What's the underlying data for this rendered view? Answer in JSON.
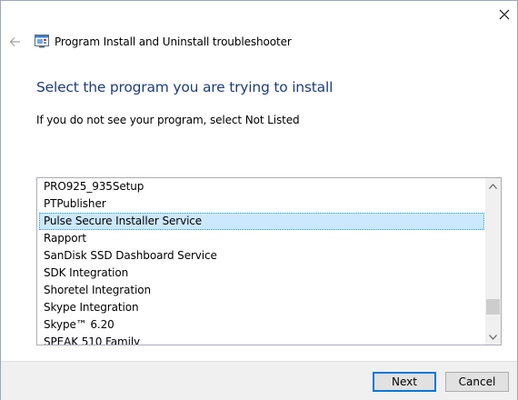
{
  "window": {
    "title": "Program Install and Uninstall troubleshooter"
  },
  "page": {
    "heading": "Select the program you are trying to install",
    "instruction": "If you do not see your program, select Not Listed"
  },
  "program_list": {
    "items": [
      {
        "label": "PRO925_935Setup",
        "selected": false
      },
      {
        "label": "PTPublisher",
        "selected": false
      },
      {
        "label": "Pulse Secure Installer Service",
        "selected": true
      },
      {
        "label": "Rapport",
        "selected": false
      },
      {
        "label": "SanDisk SSD Dashboard Service",
        "selected": false
      },
      {
        "label": "SDK Integration",
        "selected": false
      },
      {
        "label": "Shoretel Integration",
        "selected": false
      },
      {
        "label": "Skype Integration",
        "selected": false
      },
      {
        "label": "Skype™ 6.20",
        "selected": false
      },
      {
        "label": "SPEAK 510 Family",
        "selected": false
      }
    ],
    "selected_item": "Pulse Secure Installer Service"
  },
  "buttons": {
    "next": "Next",
    "cancel": "Cancel"
  },
  "icons": {
    "close": "close-icon",
    "back": "back-arrow-icon",
    "app": "troubleshooter-app-icon",
    "scroll_up": "chevron-up-icon",
    "scroll_down": "chevron-down-icon"
  },
  "colors": {
    "heading": "#1e3d7a",
    "selection_bg": "#cce8ff",
    "selection_border": "#26a0da",
    "primary_button_border": "#0078d7"
  }
}
